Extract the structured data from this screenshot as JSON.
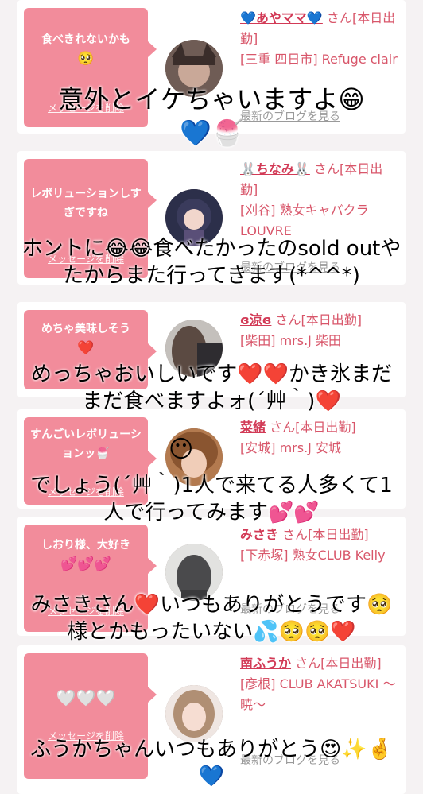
{
  "colors": {
    "background": "#f5f2f3",
    "bubble": "#f28c9b",
    "name": "#d23a56",
    "info": "#d8566a",
    "blog_link": "#9a9a9a"
  },
  "cards": [
    {
      "bubble_text": "食べきれないかも",
      "bubble_emoji": "🥺",
      "delete_label": "メッセージを削除",
      "name": "💙あやママ💙",
      "status": "さん[本日出勤]",
      "shop": "[三重 四日市] Refuge clair",
      "blog_label": "最新のブログを見る",
      "avatar_icon": "woman-with-cat-ears-avatar"
    },
    {
      "bubble_text": "レボリューションしすぎですね",
      "bubble_emoji": "",
      "delete_label": "メッセージを削除",
      "name": "🐰ちなみ🐰",
      "status": "さん[本日出勤]",
      "shop": "[刈谷] 熟女キャバクラ LOUVRE",
      "blog_label": "最新のブログを見る",
      "avatar_icon": "anime-girl-avatar"
    },
    {
      "bubble_text": "めちゃ美味しそう",
      "bubble_emoji": "❤️",
      "delete_label": "",
      "name": "ɞ涼ɞ",
      "status": "さん[本日出勤]",
      "shop": "[柴田] mrs.J 柴田",
      "blog_label": "",
      "avatar_icon": "woman-dark-hair-avatar"
    },
    {
      "bubble_text": "すんごいレボリューションッ🍧",
      "bubble_emoji": "",
      "delete_label": "メッセージを削除",
      "name": "菜緒",
      "status": "さん[本日出勤]",
      "shop": "[安城] mrs.J 安城",
      "blog_label": "",
      "avatar_icon": "woman-brown-hair-avatar"
    },
    {
      "bubble_text": "しおり様、大好き",
      "bubble_emoji": "💕💕💕",
      "delete_label": "メッセージを削除",
      "name": "みさき",
      "status": "さん[本日出勤]",
      "shop": "[下赤塚] 熟女CLUB Kelly",
      "blog_label": "最新のブログを見る",
      "avatar_icon": "woman-back-view-avatar"
    },
    {
      "bubble_text": "🤍🤍🤍",
      "bubble_emoji": "",
      "delete_label": "メッセージを削除",
      "name": "南ふうか",
      "status": "さん[本日出勤]",
      "shop": "[彦根] CLUB AKATSUKI 〜暁〜",
      "blog_label": "最新のブログを見る",
      "avatar_icon": "woman-light-hair-avatar"
    }
  ],
  "comments": [
    {
      "lines": [
        "意外とイケちゃいますよ😁",
        "💙🍧"
      ]
    },
    {
      "lines": [
        "ホントに😂😂食べたかったのsold outや",
        "たからまた行ってきます(*^^*)"
      ]
    },
    {
      "lines": [
        "めっちゃおいしいです❤️❤️かき氷まだ",
        "まだ食べますよォ(´艸｀)❤️"
      ]
    },
    {
      "lines": [
        "でしょう(´艸｀)1人で来てる人多くて1",
        "人で行ってみます💕💕"
      ]
    },
    {
      "lines": [
        "みさきさん❤️いつもありがとうです🥺",
        "様とかもったいない💦🥺🥺❤️"
      ]
    },
    {
      "lines": [
        "ふうかちゃんいつもありがとう😍✨🤞",
        "💙"
      ]
    }
  ],
  "overlay_emoji": "😶"
}
